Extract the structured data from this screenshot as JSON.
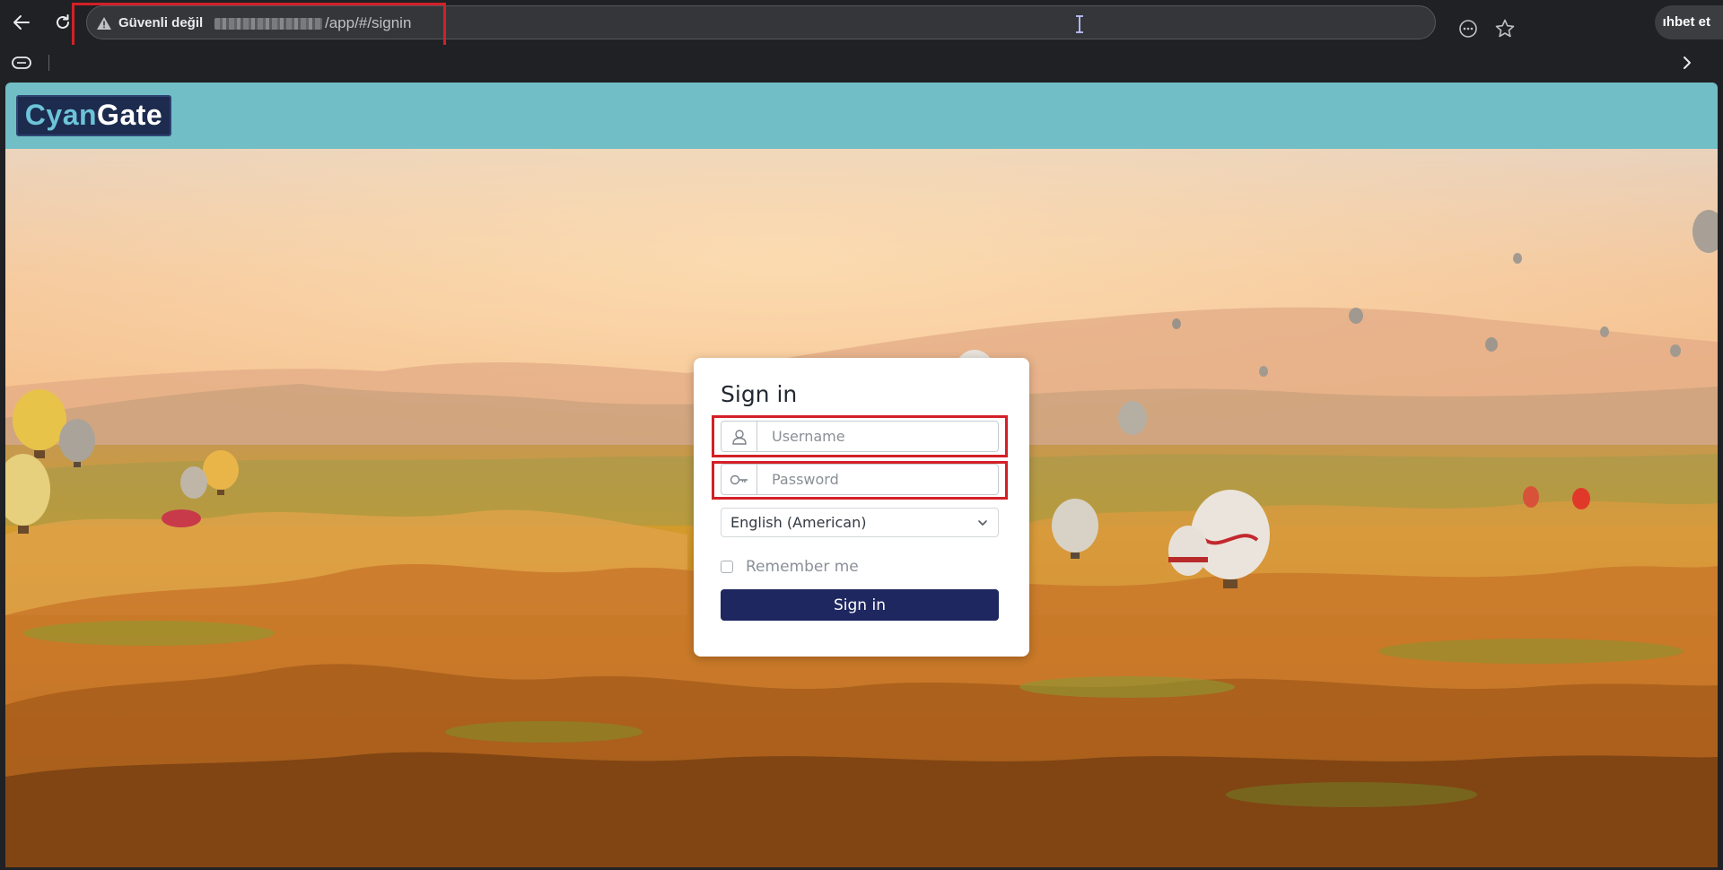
{
  "browser": {
    "security_label": "Güvenli değil",
    "url_path": "/app/#/signin",
    "chat_button_label": "ıhbet et"
  },
  "header": {
    "logo_part1": "Cyan",
    "logo_part2": "Gate"
  },
  "signin": {
    "title": "Sign in",
    "username_placeholder": "Username",
    "password_placeholder": "Password",
    "language_selected": "English (American)",
    "remember_label": "Remember me",
    "button_label": "Sign in"
  },
  "icons": {
    "back": "back-arrow-icon",
    "reload": "reload-icon",
    "warning": "warning-triangle-icon",
    "reader": "reader-mode-icon",
    "bookmark": "star-icon",
    "user": "user-icon",
    "key": "key-icon",
    "dropdown": "chevron-down-icon"
  },
  "colors": {
    "header_bg": "#71bec7",
    "logo_bg": "#1d2b4f",
    "button_bg": "#1e2760",
    "highlight": "#d32027"
  }
}
